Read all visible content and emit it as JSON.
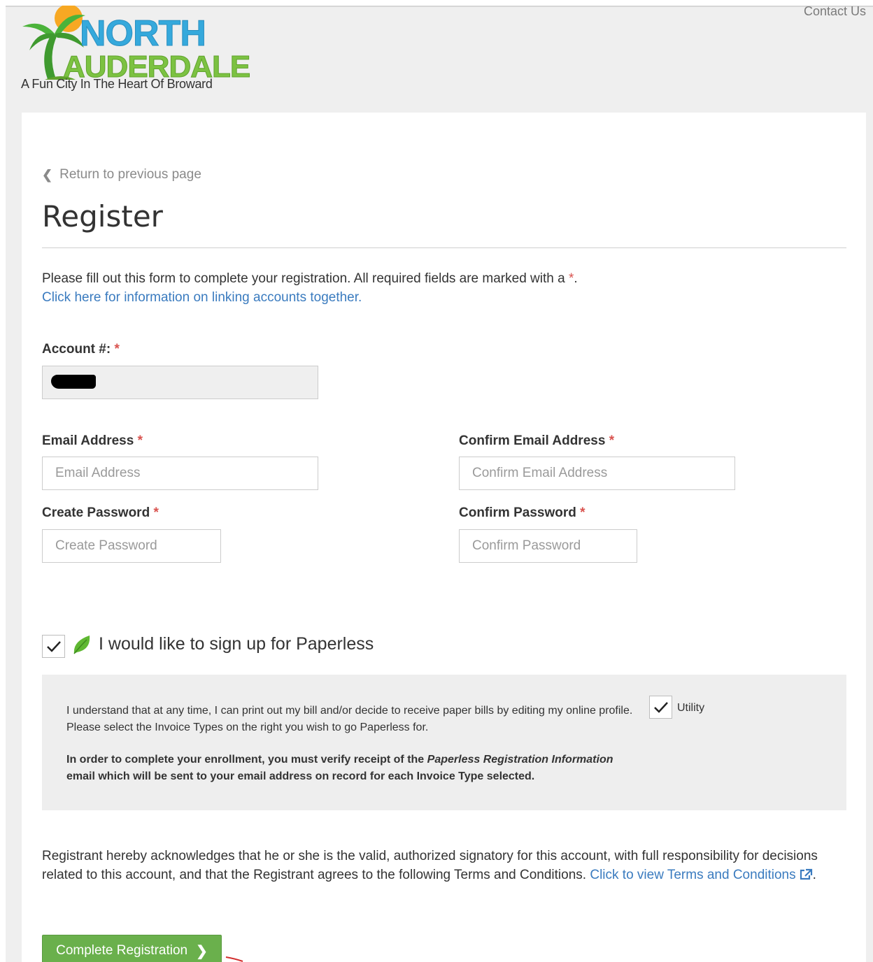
{
  "header": {
    "contact_label": "Contact Us",
    "logo": {
      "line1": "NORTH",
      "line2": "AUDERDALE",
      "tagline": "A Fun City In The Heart Of Broward"
    }
  },
  "nav": {
    "back_label": "Return to previous page"
  },
  "page": {
    "title": "Register"
  },
  "intro": {
    "text": "Please fill out this form to complete your registration. All required fields are marked with a ",
    "required_marker": "*",
    "text_end": ".",
    "link_label": "Click here for information on linking accounts together."
  },
  "form": {
    "account": {
      "label": "Account #:",
      "required": "*"
    },
    "email": {
      "label": "Email Address",
      "required": "*",
      "placeholder": "Email Address"
    },
    "confirm_email": {
      "label": "Confirm Email Address",
      "required": "*",
      "placeholder": "Confirm Email Address"
    },
    "password": {
      "label": "Create Password",
      "required": "*",
      "placeholder": "Create Password"
    },
    "confirm_password": {
      "label": "Confirm Password",
      "required": "*",
      "placeholder": "Confirm Password"
    }
  },
  "paperless": {
    "label": "I would like to sign up for Paperless",
    "checked": true,
    "panel_text": "I understand that at any time, I can print out my bill and/or decide to receive paper bills by editing my online profile. Please select the Invoice Types on the right you wish to go Paperless for.",
    "panel_bold_1": "In order to complete your enrollment, you must verify receipt of the ",
    "panel_bold_italic_1": "Paperless Registration Information",
    "panel_bold_2": " email which will be sent to your email address on record for each Invoice Type selected.",
    "utility_label": "Utility",
    "utility_checked": true
  },
  "acknowledgement": {
    "text": "Registrant hereby acknowledges that he or she is the valid, authorized signatory for this account, with full responsibility for decisions related to this account, and that the Registrant agrees to the following Terms and Conditions. ",
    "link_label": "Click to view Terms and Conditions",
    "text_end": "."
  },
  "submit": {
    "label": "Complete Registration"
  },
  "colors": {
    "accent_link": "#3a7bbf",
    "required": "#d9534f",
    "button": "#6ab04c"
  }
}
